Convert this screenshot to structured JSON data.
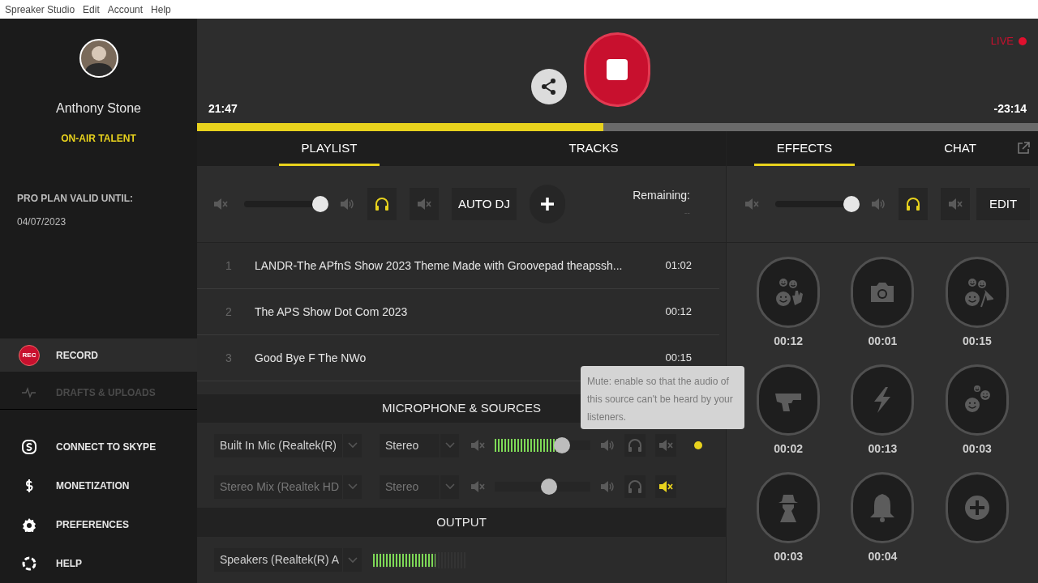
{
  "menu": [
    "Spreaker Studio",
    "Edit",
    "Account",
    "Help"
  ],
  "profile": {
    "name": "Anthony Stone",
    "role": "ON-AIR TALENT"
  },
  "plan": {
    "label": "PRO PLAN VALID UNTIL:",
    "date": "04/07/2023"
  },
  "nav": [
    {
      "label": "RECORD",
      "badge": "REC",
      "selected": true,
      "disabled": false
    },
    {
      "label": "DRAFTS & UPLOADS",
      "selected": false,
      "disabled": true
    },
    {
      "label": "CONNECT TO SKYPE",
      "selected": false,
      "disabled": false
    },
    {
      "label": "MONETIZATION",
      "selected": false,
      "disabled": false
    },
    {
      "label": "PREFERENCES",
      "selected": false,
      "disabled": false
    },
    {
      "label": "HELP",
      "selected": false,
      "disabled": false
    }
  ],
  "player": {
    "elapsed": "21:47",
    "remaining": "-23:14",
    "live": "LIVE",
    "progress": {
      "level": 0.483
    }
  },
  "left_tabs": [
    {
      "label": "PLAYLIST",
      "selected": true
    },
    {
      "label": "TRACKS",
      "selected": false
    }
  ],
  "right_tabs": [
    {
      "label": "EFFECTS",
      "selected": true
    },
    {
      "label": "CHAT",
      "selected": false
    }
  ],
  "playlist_controls": {
    "volume": {
      "level": 0.96
    },
    "headphones_on": true,
    "muted": false,
    "auto_dj": "AUTO DJ",
    "remaining_label": "Remaining:",
    "remaining_value": "--"
  },
  "playlist": [
    {
      "number": "1",
      "title": "LANDR-The APfnS Show 2023 Theme Made with Groovepad theapssh...",
      "duration": "01:02"
    },
    {
      "number": "2",
      "title": "The APS Show Dot Com 2023",
      "duration": "00:12"
    },
    {
      "number": "3",
      "title": "Good Bye F The NWo",
      "duration": "00:15"
    }
  ],
  "sources": {
    "title": "MICROPHONE & SOURCES",
    "rows": [
      {
        "device": "Built In Mic (Realtek(R)",
        "mode": "Stereo",
        "volume": {
          "level": 0.7
        },
        "meter": {
          "level": 0.7
        },
        "headphones_on": false,
        "muted": false,
        "active": true
      },
      {
        "device": "Stereo Mix (Realtek HD",
        "mode": "Stereo",
        "volume": {
          "level": 0.57
        },
        "headphones_on": false,
        "muted": true,
        "active": false
      }
    ]
  },
  "output": {
    "title": "OUTPUT",
    "device": "Speakers (Realtek(R) A",
    "meter": {
      "level": 0.67
    }
  },
  "effects_controls": {
    "volume": {
      "level": 0.96
    },
    "headphones_on": true,
    "muted": false,
    "edit": "EDIT"
  },
  "effects": [
    {
      "kind": "crowd-wave",
      "duration": "00:12"
    },
    {
      "kind": "camera",
      "duration": "00:01"
    },
    {
      "kind": "crowd-flag",
      "duration": "00:15"
    },
    {
      "kind": "pistol",
      "duration": "00:02"
    },
    {
      "kind": "lightning",
      "duration": "00:13"
    },
    {
      "kind": "faces",
      "duration": "00:03"
    },
    {
      "kind": "spy",
      "duration": "00:03"
    },
    {
      "kind": "bell",
      "duration": "00:04"
    },
    {
      "kind": "add"
    }
  ],
  "tooltip": "Mute: enable so that the audio of this source can't be heard by your listeners."
}
